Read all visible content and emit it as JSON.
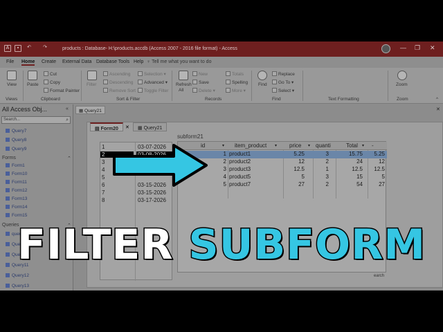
{
  "title_bar": {
    "title": "products : Database- H:\\products.accdb (Access 2007 - 2016 file format)  -  Access"
  },
  "menu": [
    "File",
    "Home",
    "Create",
    "External Data",
    "Database Tools",
    "Help"
  ],
  "menu_active": "Home",
  "tell_me": "Tell me what you want to do",
  "ribbon": {
    "view": "View",
    "paste": "Paste",
    "cut": "Cut",
    "copy": "Copy",
    "format_painter": "Format Painter",
    "filter": "Filter",
    "ascending": "Ascending",
    "descending": "Descending",
    "remove_sort": "Remove Sort",
    "selection": "Selection",
    "advanced": "Advanced",
    "toggle_filter": "Toggle Filter",
    "refresh": "Refresh",
    "refresh_all": "All",
    "new": "New",
    "save": "Save",
    "delete": "Delete",
    "totals": "Totals",
    "spelling": "Spelling",
    "more": "More",
    "find": "Find",
    "replace": "Replace",
    "go_to": "Go To",
    "select": "Select",
    "zoom": "Zoom",
    "groups": {
      "views": "Views",
      "clipboard": "Clipboard",
      "sort_filter": "Sort & Filter",
      "records": "Records",
      "find": "Find",
      "text_formatting": "Text Formatting",
      "zoom": "Zoom"
    }
  },
  "nav": {
    "header": "All Access Obj...",
    "search_placeholder": "Search...",
    "items_top": [
      "Query7",
      "Query8",
      "Query9"
    ],
    "forms_label": "Forms",
    "forms": [
      "Form1",
      "Form10",
      "Form11",
      "Form12",
      "Form13",
      "Form14",
      "Form15"
    ],
    "queries_label": "Queries",
    "queries": [
      "query_prod",
      "Query1",
      "Query10",
      "Query11",
      "Query12",
      "Query13"
    ]
  },
  "doc_tabs": [
    "Query21"
  ],
  "form_tabs": [
    "Form20",
    "Query21"
  ],
  "main_rows": [
    {
      "n": "1",
      "d": "03-07-2026"
    },
    {
      "n": "2",
      "d": "03-08-2026"
    },
    {
      "n": "3",
      "d": "03-09-2026"
    },
    {
      "n": "4",
      "d": ""
    },
    {
      "n": "5",
      "d": ""
    },
    {
      "n": "6",
      "d": "03-15-2026"
    },
    {
      "n": "7",
      "d": "03-15-2026"
    },
    {
      "n": "8",
      "d": "03-17-2026"
    }
  ],
  "subform": {
    "label": "subform21",
    "headers": [
      "id",
      "item_product",
      "price",
      "quanti",
      "Total",
      "-"
    ],
    "rows": [
      [
        "1",
        "product1",
        "5.25",
        "3",
        "15.75",
        "5.25"
      ],
      [
        "2",
        "product2",
        "12",
        "2",
        "24",
        "12"
      ],
      [
        "3",
        "product3",
        "12.5",
        "1",
        "12.5",
        "12.5"
      ],
      [
        "4",
        "product5",
        "5",
        "3",
        "15",
        "5"
      ],
      [
        "5",
        "product7",
        "27",
        "2",
        "54",
        "27"
      ]
    ],
    "nav_text": "earch"
  },
  "headline": {
    "word1": "FILTER",
    "word2": "SUBFORM"
  },
  "colors": {
    "title_bar": "#6e1f1f",
    "arrow_fill": "#35c6e3",
    "headline_accent": "#35c6e3",
    "selection": "#6a86a8"
  }
}
